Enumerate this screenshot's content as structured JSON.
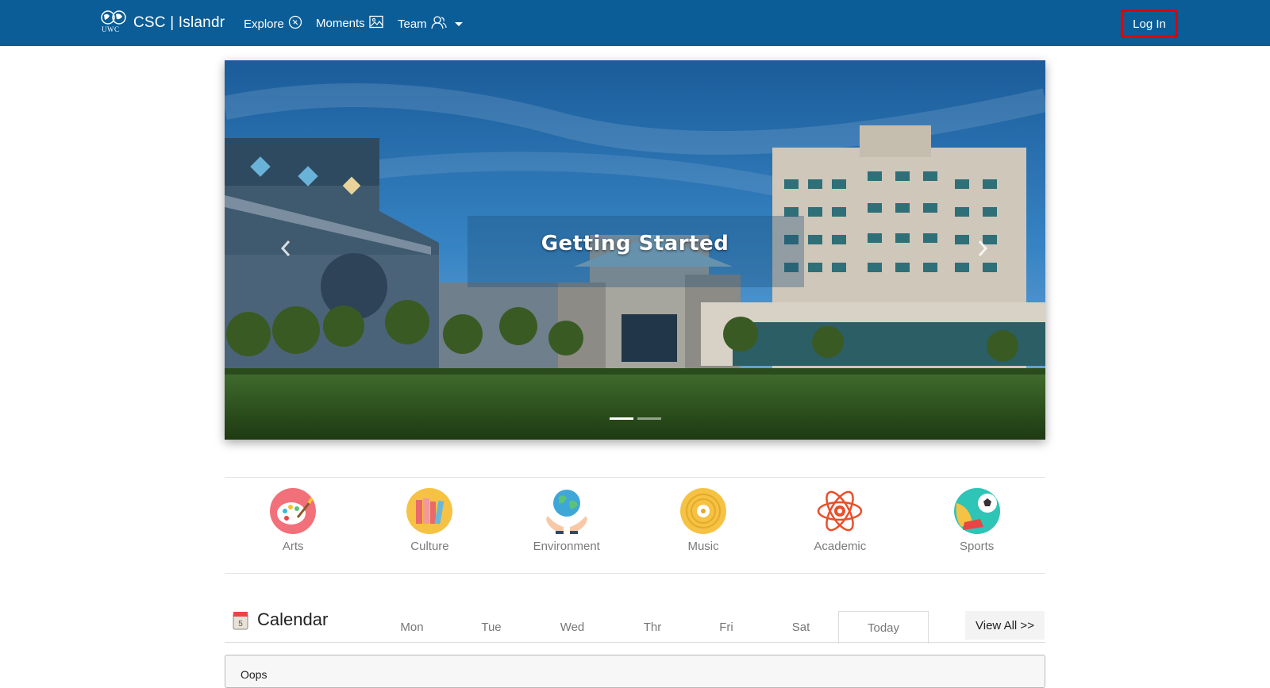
{
  "navbar": {
    "logo_text": "UWC",
    "brand": "CSC | Islandr",
    "links": [
      {
        "label": "Explore",
        "icon": "compass-icon"
      },
      {
        "label": "Moments",
        "icon": "image-icon"
      },
      {
        "label": "Team",
        "icon": "users-icon"
      }
    ],
    "login": "Log In",
    "login_highlight": "#e00000",
    "bg_color": "#0a5d97"
  },
  "carousel": {
    "caption": "Getting Started",
    "slide_count": 2,
    "active_index": 0
  },
  "categories": [
    {
      "label": "Arts",
      "icon": "palette-icon"
    },
    {
      "label": "Culture",
      "icon": "books-icon"
    },
    {
      "label": "Environment",
      "icon": "globe-hands-icon"
    },
    {
      "label": "Music",
      "icon": "vinyl-record-icon"
    },
    {
      "label": "Academic",
      "icon": "atom-icon"
    },
    {
      "label": "Sports",
      "icon": "soccer-icon"
    }
  ],
  "calendar": {
    "title": "Calendar",
    "icon_day": "5",
    "days": [
      "Mon",
      "Tue",
      "Wed",
      "Thr",
      "Fri",
      "Sat",
      "Today"
    ],
    "active_day": "Today",
    "view_all": "View All >>",
    "message": "Oops"
  }
}
